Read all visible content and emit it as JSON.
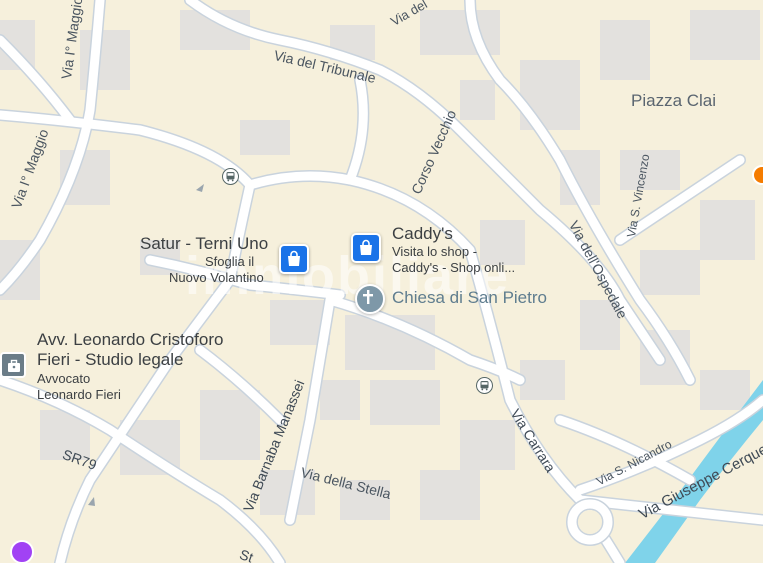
{
  "streets": {
    "via_del_tribunale": "Via del Tribunale",
    "via_i_maggio_top": "Via I° Maggio",
    "via_i_maggio_left": "Via I° Maggio",
    "corso_vecchio": "Corso Vecchio",
    "via_dell_ospedale": "Via dell'Ospedale",
    "via_s_vincenzo": "Via S. Vincenzo",
    "via_barnaba_manassei": "Via Barnaba Manassei",
    "via_della_stella": "Via della Stella",
    "via_carrara": "Via Carrara",
    "via_s_nicandro": "Via S. Nicandro",
    "via_giuseppe_cerquetti": "Via Giuseppe Cerquetti",
    "sr79": "SR79",
    "via_del_top": "Via del",
    "st_bottom": "St"
  },
  "squares": {
    "piazza_clai": "Piazza Clai"
  },
  "pois": {
    "caddys": {
      "title": "Caddy's",
      "line1": "Visita lo shop -",
      "line2": "Caddy's - Shop onli..."
    },
    "satur": {
      "title": "Satur - Terni Uno",
      "line1": "Sfoglia il",
      "line2": "Nuovo Volantino"
    },
    "chiesa": {
      "title": "Chiesa di San Pietro"
    },
    "avv": {
      "title_line1": "Avv. Leonardo Cristoforo",
      "title_line2": "Fieri - Studio legale",
      "line1": "Avvocato",
      "line2": "Leonardo Fieri"
    }
  },
  "watermark": "immobiliare",
  "colors": {
    "background": "#f6f0dc",
    "road": "#ffffff",
    "road_edge": "#c9d3dd",
    "building": "#e8e4dc",
    "river": "#7fd3ea",
    "shop_pin": "#1a73e8",
    "church_pin": "#7e98a8"
  },
  "icons": {
    "shop": "shopping-bag-icon",
    "church": "cross-icon",
    "bus": "bus-icon",
    "office": "briefcase-icon"
  }
}
